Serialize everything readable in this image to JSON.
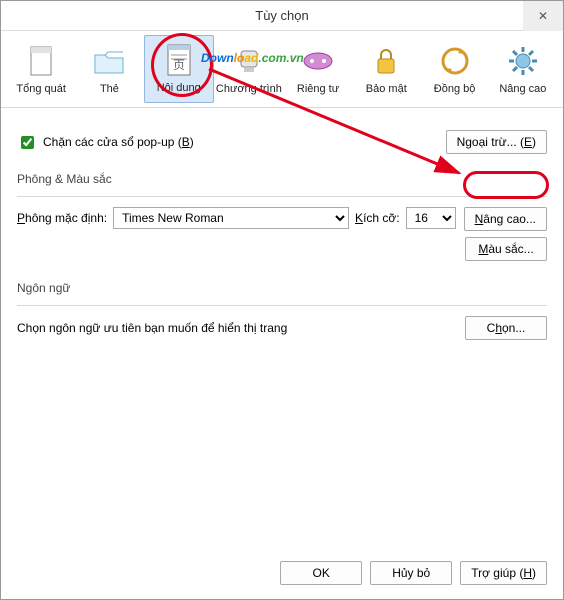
{
  "titlebar": {
    "title": "Tùy chọn",
    "close_glyph": "✕"
  },
  "tabs": {
    "general": "Tổng quát",
    "tabs_label": "Thẻ",
    "content": "Nội dung",
    "programs": "Chương trình",
    "privacy": "Riêng tư",
    "security": "Bảo mật",
    "sync": "Đồng bộ",
    "advanced": "Nâng cao"
  },
  "popup": {
    "label_pre": "Chặn các cửa sổ pop-up (",
    "label_key": "B",
    "label_post": ")",
    "except_btn_pre": "Ngoại trừ... (",
    "except_btn_key": "E",
    "except_btn_post": ")"
  },
  "fonts": {
    "section_title": "Phông & Màu sắc",
    "default_font_pre": "",
    "default_font_key": "P",
    "default_font_mid": "hông mặc định:",
    "font_name": "Times New Roman",
    "size_pre": "",
    "size_key": "K",
    "size_mid": "ích cỡ:",
    "size_value": "16",
    "advanced_btn_pre": "",
    "advanced_btn_key": "N",
    "advanced_btn_mid": "âng cao...",
    "colors_btn_pre": "",
    "colors_btn_key": "M",
    "colors_btn_mid": "àu sắc..."
  },
  "language": {
    "section_title": "Ngôn ngữ",
    "desc": "Chọn ngôn ngữ ưu tiên bạn muốn để hiển thị trang",
    "choose_btn_pre": "C",
    "choose_btn_key": "h",
    "choose_btn_mid": "ọn..."
  },
  "footer": {
    "ok": "OK",
    "cancel": "Hủy bỏ",
    "help_pre": "Trợ giúp (",
    "help_key": "H",
    "help_post": ")"
  },
  "watermark": {
    "t1": "Down",
    "t2": "lo",
    "t3": "ad",
    "t4": ".com.vn"
  }
}
